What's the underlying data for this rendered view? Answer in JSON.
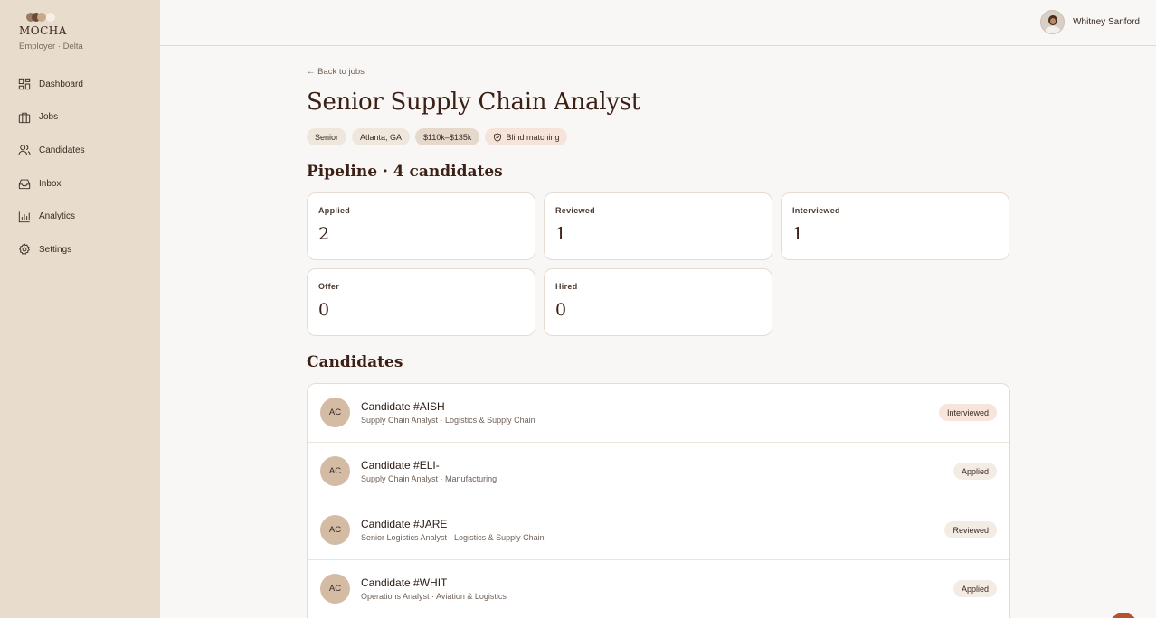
{
  "brand": {
    "name": "MOCHA",
    "subtitle": "Employer · Delta",
    "dot_colors": [
      "#9a7a62",
      "#6b4a36",
      "#c7a98e",
      "#f5efe6"
    ]
  },
  "sidebar": {
    "items": [
      {
        "label": "Dashboard",
        "icon": "dashboard-icon"
      },
      {
        "label": "Jobs",
        "icon": "briefcase-icon"
      },
      {
        "label": "Candidates",
        "icon": "users-icon"
      },
      {
        "label": "Inbox",
        "icon": "inbox-icon"
      },
      {
        "label": "Analytics",
        "icon": "bar-chart-icon"
      },
      {
        "label": "Settings",
        "icon": "gear-icon"
      }
    ]
  },
  "header": {
    "user_name": "Whitney Sanford"
  },
  "job": {
    "back_label": "← Back to jobs",
    "title": "Senior Supply Chain Analyst",
    "tags": [
      "Senior",
      "Atlanta, GA",
      "$110k–$135k",
      "Blind matching"
    ]
  },
  "pipeline": {
    "title": "Pipeline · 4 candidates",
    "stages": [
      {
        "label": "Applied",
        "value": "2"
      },
      {
        "label": "Reviewed",
        "value": "1"
      },
      {
        "label": "Interviewed",
        "value": "1"
      },
      {
        "label": "Offer",
        "value": "0"
      },
      {
        "label": "Hired",
        "value": "0"
      }
    ]
  },
  "candidates": {
    "title": "Candidates",
    "rows": [
      {
        "initials": "AC",
        "name": "Candidate #AISH",
        "subtitle": "Supply Chain Analyst · Logistics & Supply Chain",
        "status": "Interviewed"
      },
      {
        "initials": "AC",
        "name": "Candidate #ELI-",
        "subtitle": "Supply Chain Analyst · Manufacturing",
        "status": "Applied"
      },
      {
        "initials": "AC",
        "name": "Candidate #JARE",
        "subtitle": "Senior Logistics Analyst · Logistics & Supply Chain",
        "status": "Reviewed"
      },
      {
        "initials": "AC",
        "name": "Candidate #WHIT",
        "subtitle": "Operations Analyst · Aviation & Logistics",
        "status": "Applied"
      }
    ]
  },
  "colors": {
    "sidebar_bg": "#e8dccd",
    "page_bg": "#f9f7f5",
    "accent": "#b5512e",
    "tag_bg": "#efe6dc",
    "tag_salary_bg": "#e6d8ca",
    "tag_blind_bg": "#f6e3da",
    "status_interviewed_bg": "#f7e4db",
    "status_default_bg": "#f3ece4"
  }
}
